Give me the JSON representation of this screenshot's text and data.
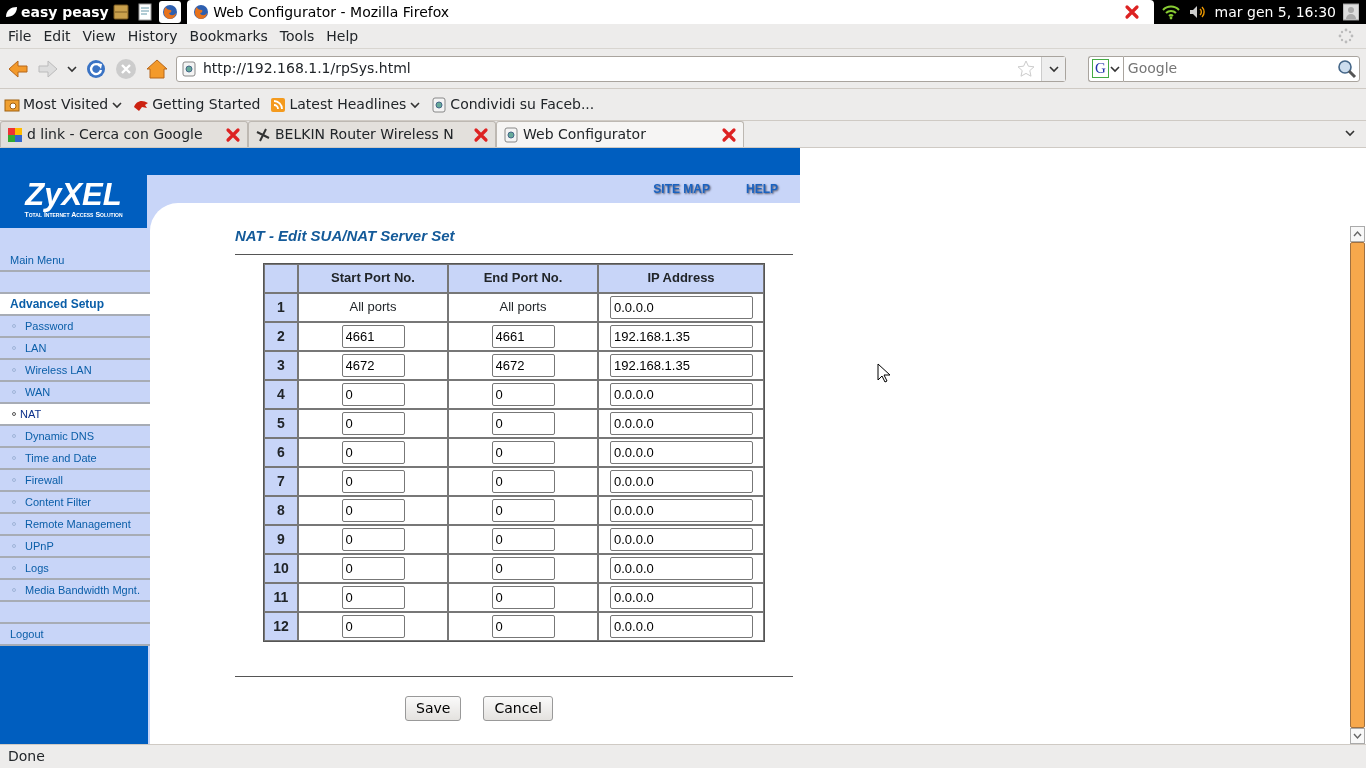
{
  "desktop_panel": {
    "menu": "easy peasy",
    "window_title": "Web Configurator - Mozilla Firefox",
    "clock": "mar gen  5, 16:30"
  },
  "menu_bar": [
    "File",
    "Edit",
    "View",
    "History",
    "Bookmarks",
    "Tools",
    "Help"
  ],
  "address_bar": {
    "url": "http://192.168.1.1/rpSys.html"
  },
  "search": {
    "engine": "G",
    "placeholder": "Google"
  },
  "bookmarks": [
    {
      "label": "Most Visited",
      "dropdown": true
    },
    {
      "label": "Getting Started",
      "dropdown": false
    },
    {
      "label": "Latest Headlines",
      "dropdown": true
    },
    {
      "label": "Condividi su Faceb...",
      "dropdown": false
    }
  ],
  "tabs": [
    {
      "label": "d link - Cerca con Google",
      "selected": false
    },
    {
      "label": "BELKIN Router Wireless N",
      "selected": false
    },
    {
      "label": "Web Configurator",
      "selected": true
    }
  ],
  "page": {
    "logo": "ZyXEL",
    "logo_tagline": "Total Internet Access Solution",
    "header_links": [
      "SITE MAP",
      "HELP"
    ],
    "sidebar": [
      {
        "kind": "link",
        "label": "Main Menu"
      },
      {
        "kind": "spacer"
      },
      {
        "kind": "heading",
        "label": "Advanced Setup"
      },
      {
        "kind": "subitem",
        "label": "Password",
        "selected": false
      },
      {
        "kind": "subitem",
        "label": "LAN",
        "selected": false
      },
      {
        "kind": "subitem",
        "label": "Wireless LAN",
        "selected": false
      },
      {
        "kind": "subitem",
        "label": "WAN",
        "selected": false
      },
      {
        "kind": "subitem",
        "label": "NAT",
        "selected": true
      },
      {
        "kind": "subitem",
        "label": "Dynamic DNS",
        "selected": false
      },
      {
        "kind": "subitem",
        "label": "Time and Date",
        "selected": false
      },
      {
        "kind": "subitem",
        "label": "Firewall",
        "selected": false
      },
      {
        "kind": "subitem",
        "label": "Content Filter",
        "selected": false
      },
      {
        "kind": "subitem",
        "label": "Remote Management",
        "selected": false
      },
      {
        "kind": "subitem",
        "label": "UPnP",
        "selected": false
      },
      {
        "kind": "subitem",
        "label": "Logs",
        "selected": false
      },
      {
        "kind": "subitem",
        "label": "Media Bandwidth Mgnt.",
        "selected": false
      },
      {
        "kind": "spacer"
      },
      {
        "kind": "link",
        "label": "Logout"
      }
    ],
    "title": "NAT - Edit SUA/NAT Server Set",
    "table": {
      "columns": [
        "Start Port No.",
        "End Port No.",
        "IP Address"
      ],
      "rows": [
        {
          "number": "1",
          "kind": "text",
          "start": "All ports",
          "end": "All ports",
          "ip": "0.0.0.0"
        },
        {
          "number": "2",
          "kind": "input",
          "start": "4661",
          "end": "4661",
          "ip": "192.168.1.35"
        },
        {
          "number": "3",
          "kind": "input",
          "start": "4672",
          "end": "4672",
          "ip": "192.168.1.35"
        },
        {
          "number": "4",
          "kind": "input",
          "start": "0",
          "end": "0",
          "ip": "0.0.0.0"
        },
        {
          "number": "5",
          "kind": "input",
          "start": "0",
          "end": "0",
          "ip": "0.0.0.0"
        },
        {
          "number": "6",
          "kind": "input",
          "start": "0",
          "end": "0",
          "ip": "0.0.0.0"
        },
        {
          "number": "7",
          "kind": "input",
          "start": "0",
          "end": "0",
          "ip": "0.0.0.0"
        },
        {
          "number": "8",
          "kind": "input",
          "start": "0",
          "end": "0",
          "ip": "0.0.0.0"
        },
        {
          "number": "9",
          "kind": "input",
          "start": "0",
          "end": "0",
          "ip": "0.0.0.0"
        },
        {
          "number": "10",
          "kind": "input",
          "start": "0",
          "end": "0",
          "ip": "0.0.0.0"
        },
        {
          "number": "11",
          "kind": "input",
          "start": "0",
          "end": "0",
          "ip": "0.0.0.0"
        },
        {
          "number": "12",
          "kind": "input",
          "start": "0",
          "end": "0",
          "ip": "0.0.0.0"
        }
      ]
    },
    "buttons": [
      "Save",
      "Cancel"
    ]
  },
  "status_bar": "Done"
}
